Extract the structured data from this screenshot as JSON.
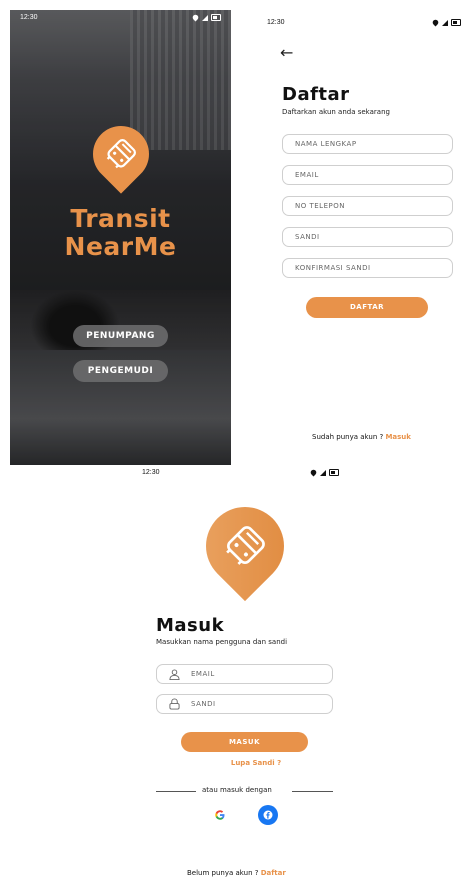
{
  "splash": {
    "status_time": "12:30",
    "logo_line1": "Transit",
    "logo_line2": "NearMe",
    "passenger_button": "PENUMPANG",
    "driver_button": "PENGEMUDI"
  },
  "register": {
    "status_time": "12:30",
    "title": "Daftar",
    "subtitle": "Daftarkan akun anda sekarang",
    "fields": {
      "full_name": "NAMA LENGKAP",
      "email": "EMAIL",
      "phone": "NO TELEPON",
      "password": "SANDI",
      "confirm_password": "KONFIRMASI SANDI"
    },
    "submit_button": "DAFTAR",
    "footer_prompt": "Sudah punya akun ?",
    "footer_link": "Masuk"
  },
  "login": {
    "status_time": "12:30",
    "title": "Masuk",
    "subtitle": "Masukkan nama pengguna dan sandi",
    "fields": {
      "email": "EMAIL",
      "password": "SANDI"
    },
    "submit_button": "MASUK",
    "forgot_password": "Lupa Sandi ?",
    "divider_text": "atau masuk dengan",
    "footer_prompt": "Belum punya akun ?",
    "footer_link": "Daftar"
  },
  "colors": {
    "accent": "#e8924a",
    "facebook": "#1877f2"
  },
  "icons": [
    "bus-icon",
    "user-icon",
    "lock-icon",
    "google-icon",
    "facebook-icon",
    "back-arrow-icon",
    "wifi-icon",
    "signal-icon",
    "battery-icon"
  ]
}
